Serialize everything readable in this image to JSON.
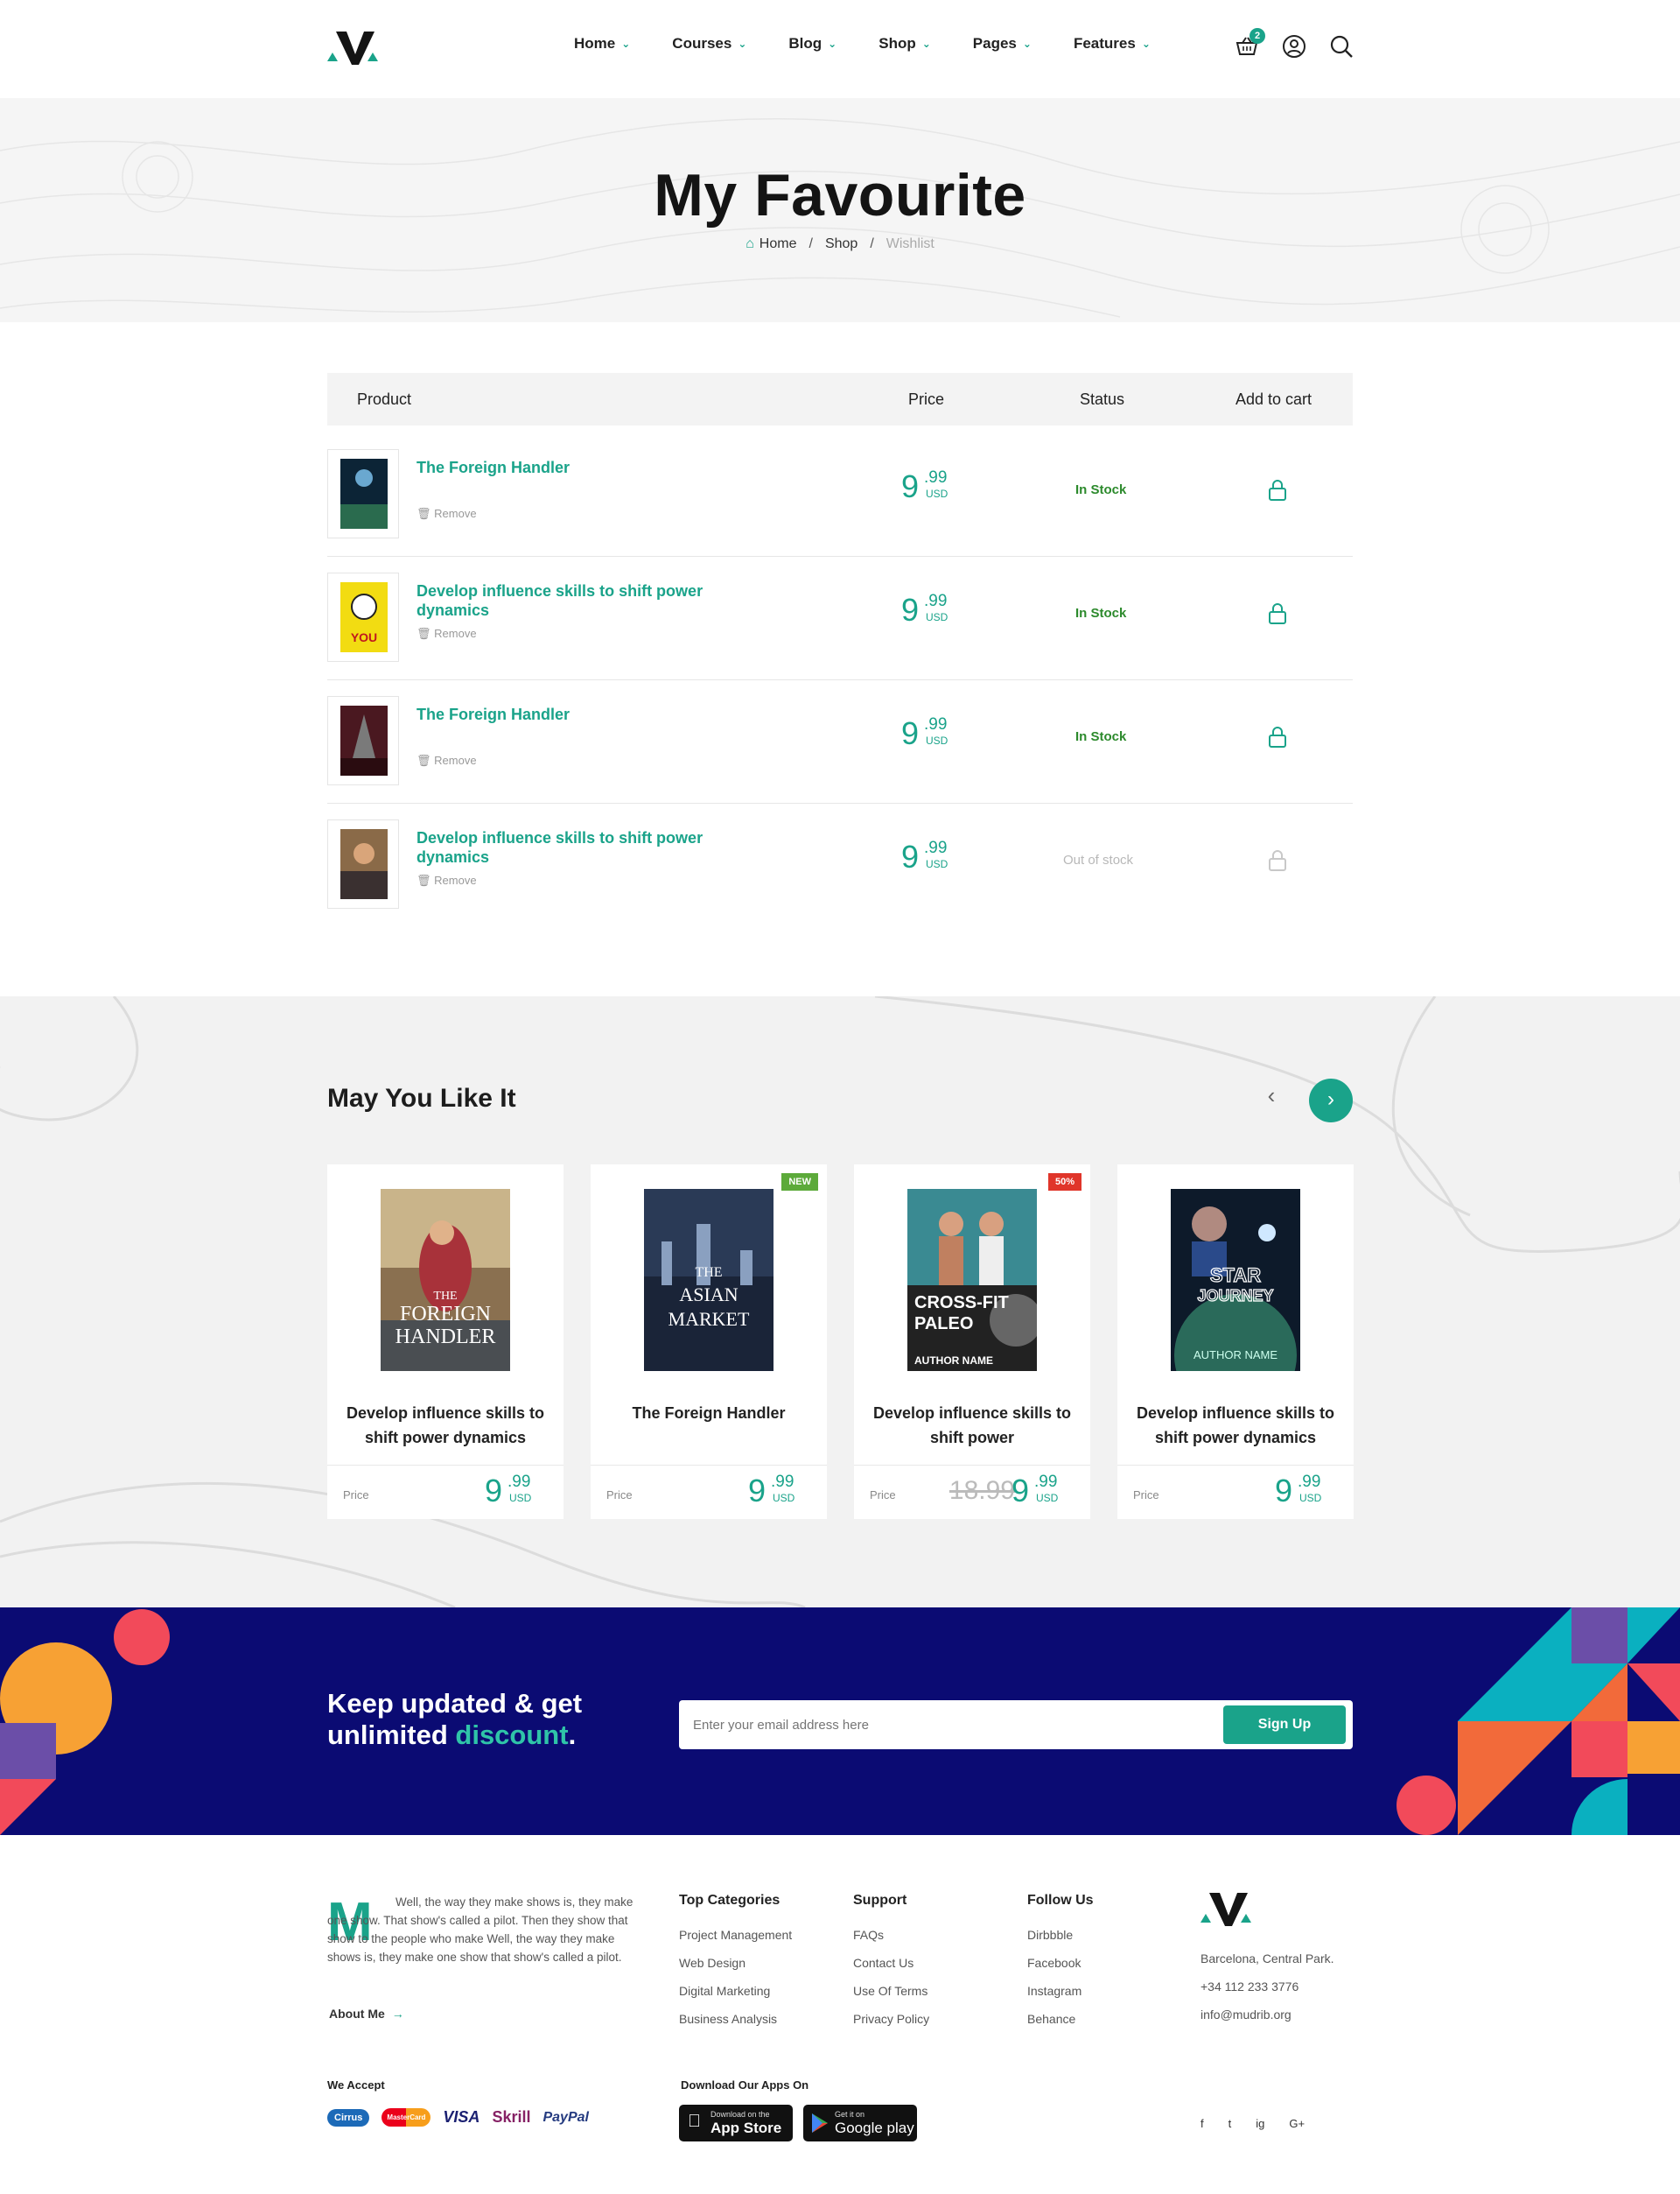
{
  "header": {
    "nav": [
      {
        "label": "Home"
      },
      {
        "label": "Courses"
      },
      {
        "label": "Blog"
      },
      {
        "label": "Shop"
      },
      {
        "label": "Pages"
      },
      {
        "label": "Features"
      }
    ],
    "cart_count": "2"
  },
  "page": {
    "title": "My Favourite",
    "breadcrumb": [
      "Home",
      "Shop",
      "Wishlist"
    ]
  },
  "wishlist": {
    "columns": [
      "Product",
      "Price",
      "Status",
      "Add to cart"
    ],
    "remove_label": "Remove",
    "rows": [
      {
        "name": "The Foreign Handler",
        "price_int": "9",
        "price_dec": ".99",
        "currency": "USD",
        "status": "In Stock",
        "in_stock": true
      },
      {
        "name": "Develop influence skills to shift power dynamics",
        "price_int": "9",
        "price_dec": ".99",
        "currency": "USD",
        "status": "In Stock",
        "in_stock": true
      },
      {
        "name": "The Foreign Handler",
        "price_int": "9",
        "price_dec": ".99",
        "currency": "USD",
        "status": "In Stock",
        "in_stock": true
      },
      {
        "name": "Develop influence skills to shift power dynamics",
        "price_int": "9",
        "price_dec": ".99",
        "currency": "USD",
        "status": "Out of stock",
        "in_stock": false
      }
    ]
  },
  "recommend": {
    "title": "May You Like It",
    "price_label": "Price",
    "cards": [
      {
        "name": "Develop influence skills to shift power dynamics",
        "tag": "",
        "old_price": "",
        "price_int": "9",
        "price_dec": ".99",
        "currency": "USD"
      },
      {
        "name": "The Foreign Handler",
        "tag": "NEW",
        "old_price": "",
        "price_int": "9",
        "price_dec": ".99",
        "currency": "USD"
      },
      {
        "name": "Develop influence skills to shift power",
        "tag": "50%",
        "old_price": "18.99",
        "price_int": "9",
        "price_dec": ".99",
        "currency": "USD"
      },
      {
        "name": "Develop influence skills to shift power dynamics",
        "tag": "",
        "old_price": "",
        "price_int": "9",
        "price_dec": ".99",
        "currency": "USD"
      }
    ],
    "covers": [
      {
        "line1": "THE",
        "line2": "FOREIGN",
        "line3": "HANDLER"
      },
      {
        "line1": "THE",
        "line2": "ASIAN",
        "line3": "MARKET"
      },
      {
        "line1": "CROSS-FIT",
        "line2": "PALEO",
        "line3": "AUTHOR NAME"
      },
      {
        "line1": "STAR",
        "line2": "JOURNEY",
        "line3": "AUTHOR NAME"
      }
    ]
  },
  "newsletter": {
    "line1": "Keep updated & get",
    "line2_a": "unlimited ",
    "line2_hl": "discount",
    "line2_b": ".",
    "placeholder": "Enter your email address here",
    "button": "Sign Up"
  },
  "footer": {
    "about_letter": "M",
    "about_text": "Well, the way they make shows is, they make one show. That show's called a pilot. Then they show that show to the people who make Well, the way they make shows is, they make one show that show's called a pilot.",
    "about_link": "About Me",
    "columns": [
      {
        "title": "Top Categories",
        "links": [
          "Project Management",
          "Web Design",
          "Digital Marketing",
          "Business Analysis"
        ]
      },
      {
        "title": "Support",
        "links": [
          "FAQs",
          "Contact Us",
          "Use Of Terms",
          "Privacy Policy"
        ]
      },
      {
        "title": "Follow Us",
        "links": [
          "Dirbbble",
          "Facebook",
          "Instagram",
          "Behance"
        ]
      }
    ],
    "contact": [
      "Barcelona, Central Park.",
      "+34 112 233 3776",
      "info@mudrib.org"
    ],
    "accept_label": "We Accept",
    "payment": [
      "Cirrus",
      "MasterCard",
      "VISA",
      "Skrill",
      "PayPal"
    ],
    "apps_label": "Download Our Apps On",
    "apps": [
      {
        "small": "Download on the",
        "big": "App Store"
      },
      {
        "small": "Get it on",
        "big": "Google play"
      }
    ],
    "social": [
      "f",
      "t",
      "ig",
      "G+"
    ]
  },
  "colors": {
    "accent": "#1aa38a",
    "navy": "#0b0b73",
    "stock": "#2c8a2c"
  }
}
